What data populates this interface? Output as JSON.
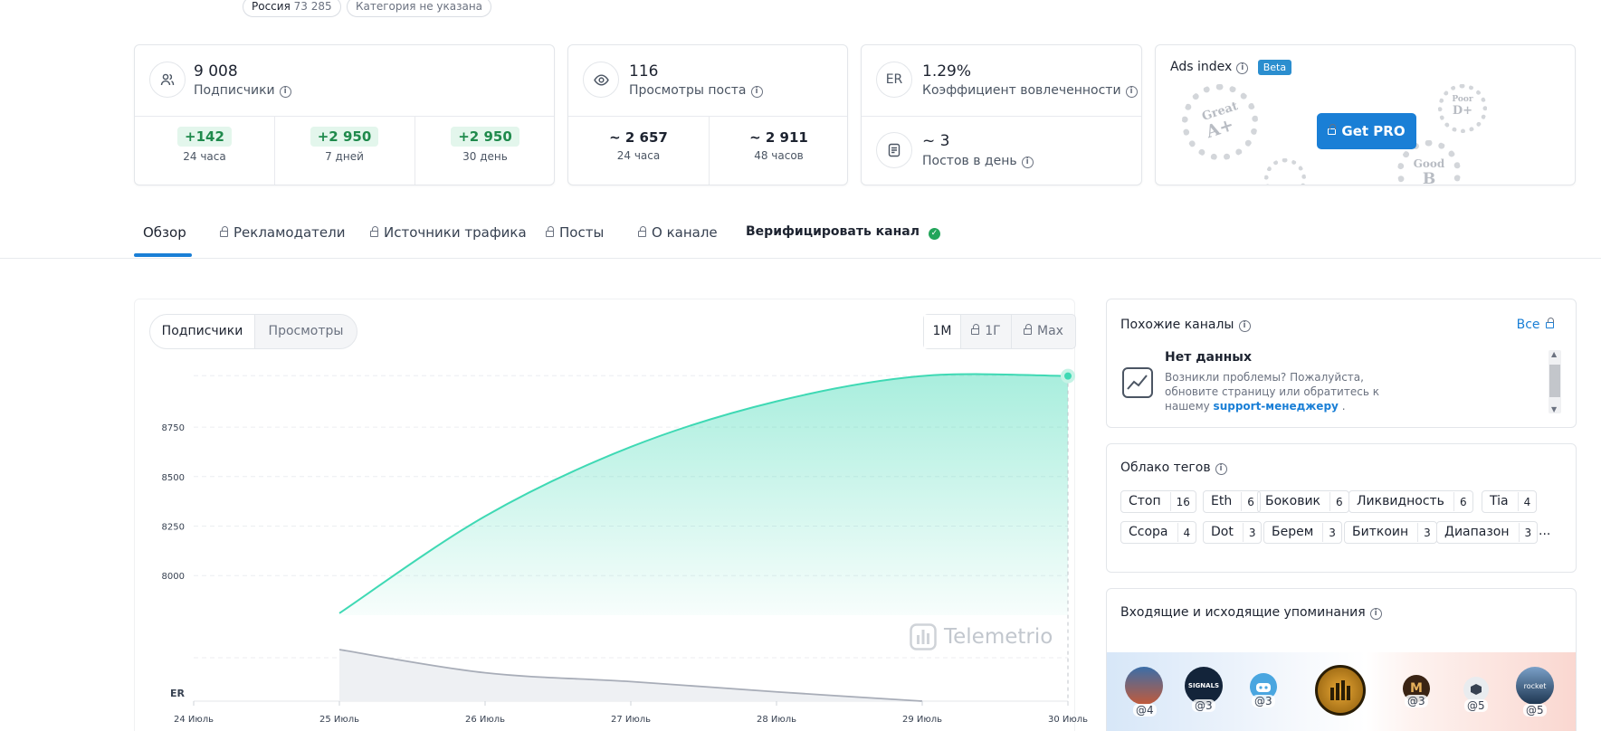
{
  "header_pills": {
    "country_name": "Россия",
    "country_count": "73 285",
    "category": "Категория не указана"
  },
  "stats": {
    "subscribers": {
      "value": "9 008",
      "label": "Подписчики",
      "deltas": [
        {
          "value": "+142",
          "label": "24 часа"
        },
        {
          "value": "+2 950",
          "label": "7 дней"
        },
        {
          "value": "+2 950",
          "label": "30 день"
        }
      ]
    },
    "post_views": {
      "value": "116",
      "label": "Просмотры поста",
      "periods": [
        {
          "value": "~ 2 657",
          "label": "24 часа"
        },
        {
          "value": "~ 2 911",
          "label": "48 часов"
        }
      ]
    },
    "engagement": {
      "icon_text": "ER",
      "value": "1.29%",
      "label": "Коэффициент вовлеченности"
    },
    "posts_per_day": {
      "value": "~ 3",
      "label": "Постов в день"
    },
    "ads_index": {
      "title": "Ads index",
      "beta": "Beta",
      "button": "Get PRO",
      "grades": [
        {
          "word": "Great",
          "grade": "A+"
        },
        {
          "word": "Poor",
          "grade": "D+"
        },
        {
          "word": "Good",
          "grade": "B"
        }
      ]
    }
  },
  "tabs": [
    {
      "label": "Обзор",
      "locked": false,
      "active": true
    },
    {
      "label": "Рекламодатели",
      "locked": true
    },
    {
      "label": "Источники трафика",
      "locked": true
    },
    {
      "label": "Посты",
      "locked": true
    },
    {
      "label": "О канале",
      "locked": true
    },
    {
      "label": "Верифицировать канал",
      "verified": true
    }
  ],
  "chart_controls": {
    "toggle": [
      "Подписчики",
      "Просмотры"
    ],
    "ranges": [
      "1М",
      "1Г",
      "Max"
    ]
  },
  "watermark": "Telemetrio",
  "chart_data": {
    "type": "area",
    "x": [
      "24 Июль",
      "25 Июль",
      "26 Июль",
      "27 Июль",
      "28 Июль",
      "29 Июль",
      "30 Июль"
    ],
    "y_ticks": [
      8000,
      8250,
      8500,
      8750
    ],
    "ylim": [
      7800,
      9020
    ],
    "series": [
      {
        "values": [
          null,
          7810,
          8300,
          8650,
          8880,
          9008,
          9008
        ],
        "color": "#3fd9b4"
      }
    ],
    "er_label": "ER",
    "er_series": {
      "values": [
        null,
        1.0,
        0.55,
        0.38,
        0.18,
        0.0,
        null
      ],
      "color": "#a8adb8"
    }
  },
  "similar": {
    "title": "Похожие каналы",
    "all": "Все",
    "empty_title": "Нет данных",
    "empty_text": "Возникли проблемы? Пожалуйста, обновите страницу или обратитесь к нашему",
    "empty_link": "support-менеджеру",
    "empty_end": "."
  },
  "tags": {
    "title": "Облако тегов",
    "more": "...",
    "items": [
      {
        "name": "Стоп",
        "count": "16"
      },
      {
        "name": "Eth",
        "count": "6"
      },
      {
        "name": "Боковик",
        "count": "6"
      },
      {
        "name": "Ликвидность",
        "count": "6"
      },
      {
        "name": "Tia",
        "count": "4"
      },
      {
        "name": "Ccopa",
        "count": "4"
      },
      {
        "name": "Dot",
        "count": "3"
      },
      {
        "name": "Берем",
        "count": "3"
      },
      {
        "name": "Биткоин",
        "count": "3"
      },
      {
        "name": "Диапазон",
        "count": "3"
      }
    ]
  },
  "mentions": {
    "title": "Входящие и исходящие упоминания",
    "items": [
      "@4",
      "@3",
      "@3",
      "@3",
      "@5",
      "@5"
    ],
    "avatar_text": [
      "SIGNALS",
      "rocket"
    ]
  }
}
